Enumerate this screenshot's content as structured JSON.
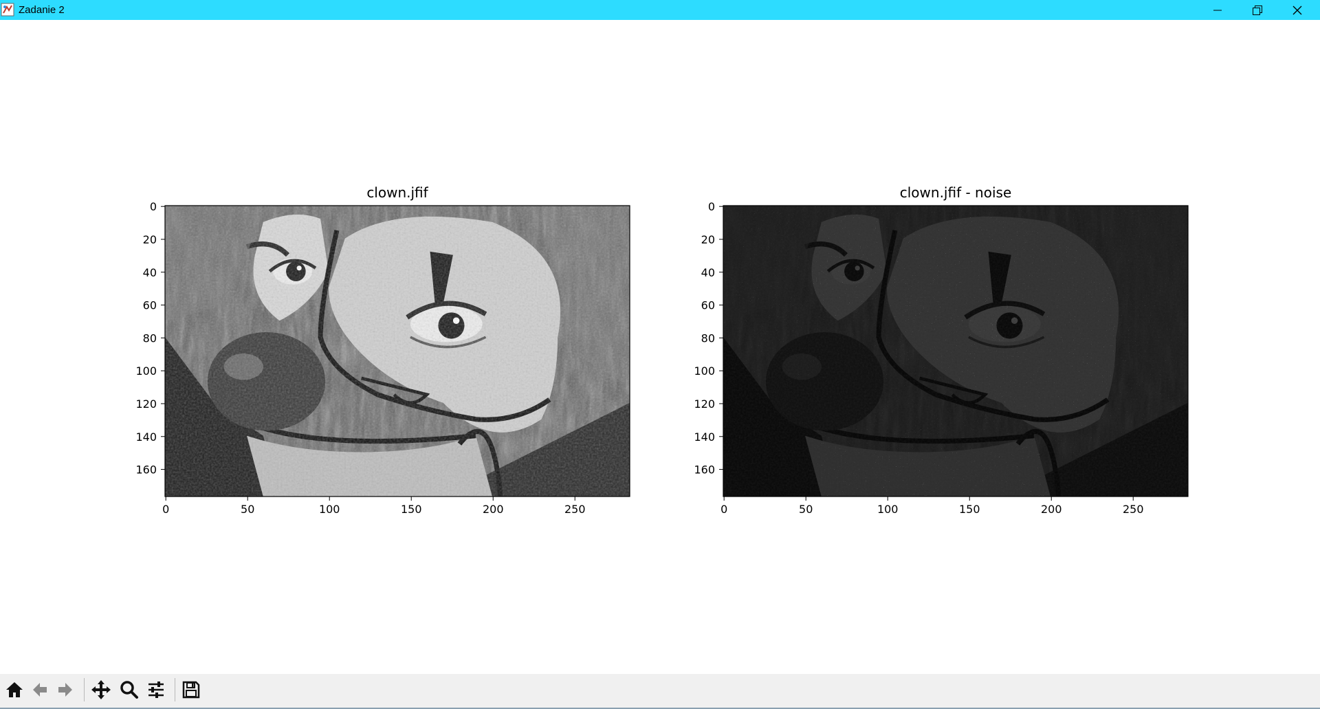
{
  "window": {
    "title": "Zadanie 2",
    "controls": [
      "minimize",
      "restore",
      "close"
    ],
    "titlebar_color": "#2ddcff"
  },
  "figure": {
    "subplots": [
      {
        "title": "clown.jfif",
        "image": "grayscale clown face"
      },
      {
        "title": "clown.jfif - noise",
        "image": "grayscale clown face with salt-and-pepper noise"
      }
    ]
  },
  "chart_data": [
    {
      "type": "image",
      "title": "clown.jfif",
      "xlim": [
        -0.5,
        283.5
      ],
      "ylim": [
        176.5,
        -0.5
      ],
      "xticks": [
        0,
        50,
        100,
        150,
        200,
        250
      ],
      "yticks": [
        0,
        20,
        40,
        60,
        80,
        100,
        120,
        140,
        160
      ],
      "xtick_labels": [
        "0",
        "50",
        "100",
        "150",
        "200",
        "250"
      ],
      "ytick_labels": [
        "0",
        "20",
        "40",
        "60",
        "80",
        "100",
        "120",
        "140",
        "160"
      ],
      "colormap": "gray"
    },
    {
      "type": "image",
      "title": "clown.jfif - noise",
      "xlim": [
        -0.5,
        283.5
      ],
      "ylim": [
        176.5,
        -0.5
      ],
      "xticks": [
        0,
        50,
        100,
        150,
        200,
        250
      ],
      "yticks": [
        0,
        20,
        40,
        60,
        80,
        100,
        120,
        140,
        160
      ],
      "xtick_labels": [
        "0",
        "50",
        "100",
        "150",
        "200",
        "250"
      ],
      "ytick_labels": [
        "0",
        "20",
        "40",
        "60",
        "80",
        "100",
        "120",
        "140",
        "160"
      ],
      "colormap": "gray",
      "noise": "salt-and-pepper"
    }
  ],
  "toolbar": {
    "buttons": [
      {
        "name": "home-icon",
        "label": "Home"
      },
      {
        "name": "back-arrow-icon",
        "label": "Back"
      },
      {
        "name": "forward-arrow-icon",
        "label": "Forward"
      },
      {
        "name": "pan-icon",
        "label": "Pan"
      },
      {
        "name": "zoom-icon",
        "label": "Zoom"
      },
      {
        "name": "configure-subplots-icon",
        "label": "Subplots"
      },
      {
        "name": "save-icon",
        "label": "Save"
      }
    ]
  }
}
